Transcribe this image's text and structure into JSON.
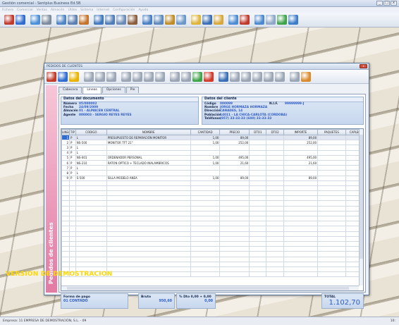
{
  "app": {
    "title": "Gestión comercial - Sentplus Business Ed.5B",
    "menu": [
      "Fichero",
      "Comercial",
      "Ventas",
      "Almacén",
      "Útiles",
      "Sistema",
      "Internet",
      "Configuración",
      "Ayuda"
    ],
    "status_left": "Empresa:  11  EMPRESA DE DEMOSTRACIÓN, S.L.  -  09",
    "status_right": "10:",
    "demo_watermark": "VERSION DE DEMOSTRACION",
    "win_min": "_",
    "win_max": "□",
    "win_close": "x"
  },
  "toolbar_icons": [
    {
      "name": "exit-icon",
      "color": "#c0392b"
    },
    {
      "name": "info-icon",
      "color": "#2f6bd0"
    },
    {
      "sep": true
    },
    {
      "name": "network-icon",
      "color": "#4a8fd8"
    },
    {
      "name": "calculator-icon",
      "color": "#7d8b9c"
    },
    {
      "sep": true
    },
    {
      "name": "users-icon",
      "color": "#4f84c4"
    },
    {
      "name": "users-search-icon",
      "color": "#5b7fb0"
    },
    {
      "name": "box-icon",
      "color": "#c4742d"
    },
    {
      "sep": true
    },
    {
      "name": "people-icon",
      "color": "#3f78bf"
    },
    {
      "name": "people-edit-icon",
      "color": "#507db7"
    },
    {
      "name": "people-add-icon",
      "color": "#6b8bb7"
    },
    {
      "name": "people-remove-icon",
      "color": "#8b5f3d"
    },
    {
      "sep": true
    },
    {
      "name": "group-icon",
      "color": "#4a7fc4"
    },
    {
      "name": "group-edit-icon",
      "color": "#5c88bd"
    },
    {
      "name": "group-money-icon",
      "color": "#bf8c2a"
    },
    {
      "name": "group-doc-icon",
      "color": "#6a96c8"
    },
    {
      "sep": true
    },
    {
      "name": "transfer-icon",
      "color": "#e0b43a"
    },
    {
      "name": "book-icon",
      "color": "#3a6fb5"
    },
    {
      "name": "chart-icon",
      "color": "#d9a73a"
    },
    {
      "sep": true
    },
    {
      "name": "document-icon",
      "color": "#4e8cd1"
    },
    {
      "name": "heart-icon",
      "color": "#c0392b"
    },
    {
      "sep": true
    },
    {
      "name": "ship-icon",
      "color": "#4a88d0"
    },
    {
      "name": "email-icon",
      "color": "#8fa8c8"
    },
    {
      "name": "refresh-icon",
      "color": "#3fa34a"
    },
    {
      "name": "globe-icon",
      "color": "#3d7cc9"
    }
  ],
  "window": {
    "title": "PEDIDOS DE CLIENTES",
    "close_label": "x",
    "side_label": "Pedidos de clientes",
    "tabs": [
      {
        "label": "Cabecera"
      },
      {
        "label": "Líneas",
        "active": true
      },
      {
        "label": "Opciones"
      },
      {
        "label": "Pie"
      }
    ],
    "toolbar_icons": [
      {
        "name": "exit-icon",
        "color": "#c0392b"
      },
      {
        "name": "info-icon",
        "color": "#2f6bd0"
      },
      {
        "name": "star-icon",
        "color": "#e8b400"
      },
      {
        "sep": true
      },
      {
        "name": "user-icon",
        "color": "#9aa5b5"
      },
      {
        "name": "document-icon",
        "color": "#9aa5b5"
      },
      {
        "name": "folder-icon",
        "color": "#9aa5b5"
      },
      {
        "sep": true
      },
      {
        "name": "copy-icon",
        "color": "#9aa5b5"
      },
      {
        "name": "move-icon",
        "color": "#9aa5b5"
      },
      {
        "name": "move-all-icon",
        "color": "#9aa5b5"
      },
      {
        "name": "tools-icon",
        "color": "#9aa5b5"
      },
      {
        "sep": true
      },
      {
        "name": "print-icon",
        "color": "#9aa5b5"
      },
      {
        "name": "preview-icon",
        "color": "#9aa5b5"
      },
      {
        "name": "check-icon",
        "color": "#3fa34a"
      },
      {
        "name": "cancel-icon",
        "color": "#d23a2a"
      },
      {
        "sep": true
      },
      {
        "name": "chart-icon",
        "color": "#3a6fb5"
      },
      {
        "name": "table-icon",
        "color": "#9aa5b5"
      },
      {
        "name": "calendar-icon",
        "color": "#9aa5b5"
      },
      {
        "name": "settings-icon",
        "color": "#9aa5b5"
      },
      {
        "name": "lock-icon",
        "color": "#9aa5b5"
      },
      {
        "name": "key-icon",
        "color": "#9aa5b5"
      },
      {
        "sep": true
      },
      {
        "name": "help-icon",
        "color": "#9aa5b5"
      },
      {
        "name": "exit-icon-2",
        "color": "#d98a2a"
      }
    ]
  },
  "document": {
    "header": "Datos del documento",
    "fields": [
      {
        "k": "Número",
        "v": "05/000002"
      },
      {
        "k": "Fecha",
        "v": "24/09/2009"
      },
      {
        "k": "Almacén",
        "v": "01 - ALMACEN CENTRAL"
      },
      {
        "k": "Agente",
        "v": "000003 - SERGIO REYES REYES"
      }
    ]
  },
  "client": {
    "header": "Datos del cliente",
    "fields": [
      {
        "k": "Código",
        "v": "000099",
        "k2": "N.I.F.",
        "v2": "99999999-J"
      },
      {
        "k": "Nombre",
        "v": "JORGE HORMAZA HORMAZA"
      },
      {
        "k": "Dirección",
        "v": "CANADES, 14"
      },
      {
        "k": "Población",
        "v": "14011 - LA CHICA-CARLOTA  (CORDOBA)"
      },
      {
        "k": "Teléfonos",
        "v": "(957) 33-33-33    (600) 33-33-33"
      }
    ]
  },
  "grid": {
    "columns": [
      "LINEA",
      "TIP",
      "CODIGO",
      "NOMBRE",
      "CANTIDAD",
      "PRECIO",
      "DTO1",
      "DTO2",
      "IMPORTE",
      "PAQUETES",
      "CAPLB"
    ],
    "rows": [
      {
        "linea": "1",
        "tip": "P",
        "codigo": "L",
        "nombre": "PRESUPUESTO DE REPARACIÓN MONITOR",
        "cantidad": "1,00",
        "precio": "89,00",
        "dto1": "",
        "dto2": "",
        "importe": "89,00",
        "paquetes": "",
        "caplb": "",
        "selected": true
      },
      {
        "linea": "2",
        "tip": "P",
        "codigo": "NS-500",
        "nombre": "MONITOR TFT 21\"",
        "cantidad": "1,00",
        "precio": "252,00",
        "dto1": "",
        "dto2": "",
        "importe": "252,00",
        "paquetes": "",
        "caplb": ""
      },
      {
        "linea": "3",
        "tip": "P",
        "codigo": "L",
        "nombre": "",
        "cantidad": "",
        "precio": "",
        "dto1": "",
        "dto2": "",
        "importe": "",
        "paquetes": "",
        "caplb": ""
      },
      {
        "linea": "4",
        "tip": "P",
        "codigo": "L",
        "nombre": "",
        "cantidad": "",
        "precio": "",
        "dto1": "",
        "dto2": "",
        "importe": "",
        "paquetes": "",
        "caplb": ""
      },
      {
        "linea": "5",
        "tip": "P",
        "codigo": "NS-001",
        "nombre": "ORDENADOR PERSONAL",
        "cantidad": "1,00",
        "precio": "495,00",
        "dto1": "",
        "dto2": "",
        "importe": "495,00",
        "paquetes": "",
        "caplb": ""
      },
      {
        "linea": "6",
        "tip": "P",
        "codigo": "NS-210",
        "nombre": "RATON OPTICO + TECLADO INALAMBRICOS",
        "cantidad": "1,00",
        "precio": "21,60",
        "dto1": "",
        "dto2": "",
        "importe": "21,60",
        "paquetes": "",
        "caplb": ""
      },
      {
        "linea": "7",
        "tip": "P",
        "codigo": "L",
        "nombre": "",
        "cantidad": "",
        "precio": "",
        "dto1": "",
        "dto2": "",
        "importe": "",
        "paquetes": "",
        "caplb": ""
      },
      {
        "linea": "8",
        "tip": "P",
        "codigo": "L",
        "nombre": "",
        "cantidad": "",
        "precio": "",
        "dto1": "",
        "dto2": "",
        "importe": "",
        "paquetes": "",
        "caplb": ""
      },
      {
        "linea": "9",
        "tip": "P",
        "codigo": "S-500",
        "nombre": "SILLA MODELO ANEA",
        "cantidad": "1,00",
        "precio": "89,00",
        "dto1": "",
        "dto2": "",
        "importe": "89,00",
        "paquetes": "",
        "caplb": ""
      }
    ],
    "empty_rows": 19
  },
  "footer": {
    "payment_label": "Forma de pago",
    "payment_value": "01  CONTADO",
    "bruto_label": "Bruto",
    "bruto_value": "950,60",
    "dto_label": "% Dto  0,00 +  0,00",
    "dto_value": "0,00",
    "total_label": "TOTAL",
    "total_value": "1.102,70"
  }
}
